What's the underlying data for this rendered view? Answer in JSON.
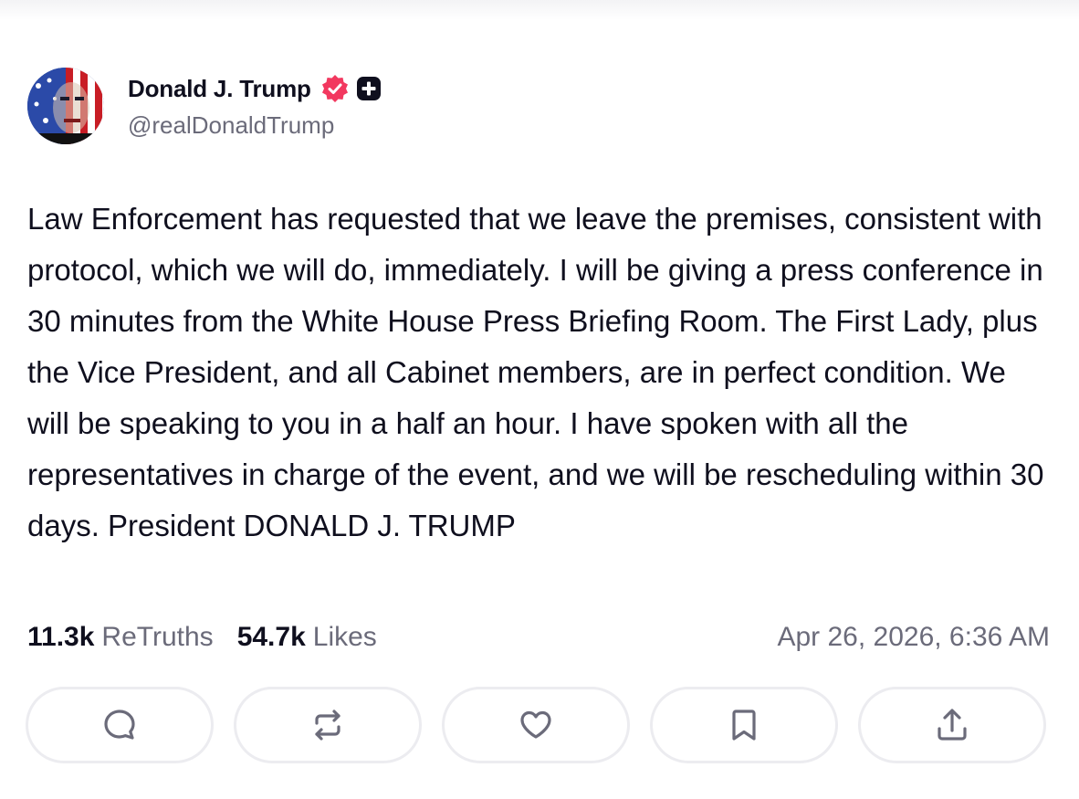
{
  "author": {
    "display_name": "Donald J. Trump",
    "handle": "@realDonaldTrump",
    "verified": true,
    "verified_color": "#f2385f",
    "badge_icon": "plus-badge-icon"
  },
  "post": {
    "text": "Law Enforcement has requested that we leave the premises, consistent with protocol, which we will do, immediately. I will be giving a press conference in 30 minutes from the White House Press Briefing Room. The First Lady, plus the Vice President, and all Cabinet members, are in perfect condition. We will be speaking to you in a half an hour. I have spoken with all the representatives in charge of the event, and we will be rescheduling within 30 days. President DONALD J. TRUMP"
  },
  "stats": {
    "retruths_count": "11.3k",
    "retruths_label": "ReTruths",
    "likes_count": "54.7k",
    "likes_label": "Likes",
    "timestamp": "Apr 26, 2026, 6:36 AM"
  },
  "actions": [
    {
      "name": "reply",
      "icon": "comment-icon"
    },
    {
      "name": "retruth",
      "icon": "repost-icon"
    },
    {
      "name": "like",
      "icon": "heart-icon"
    },
    {
      "name": "bookmark",
      "icon": "bookmark-icon"
    },
    {
      "name": "share",
      "icon": "share-icon"
    }
  ],
  "colors": {
    "text_primary": "#0f0f1e",
    "text_secondary": "#6b6b7a",
    "button_border": "#ececf0",
    "icon_color": "#6b6b7a"
  }
}
